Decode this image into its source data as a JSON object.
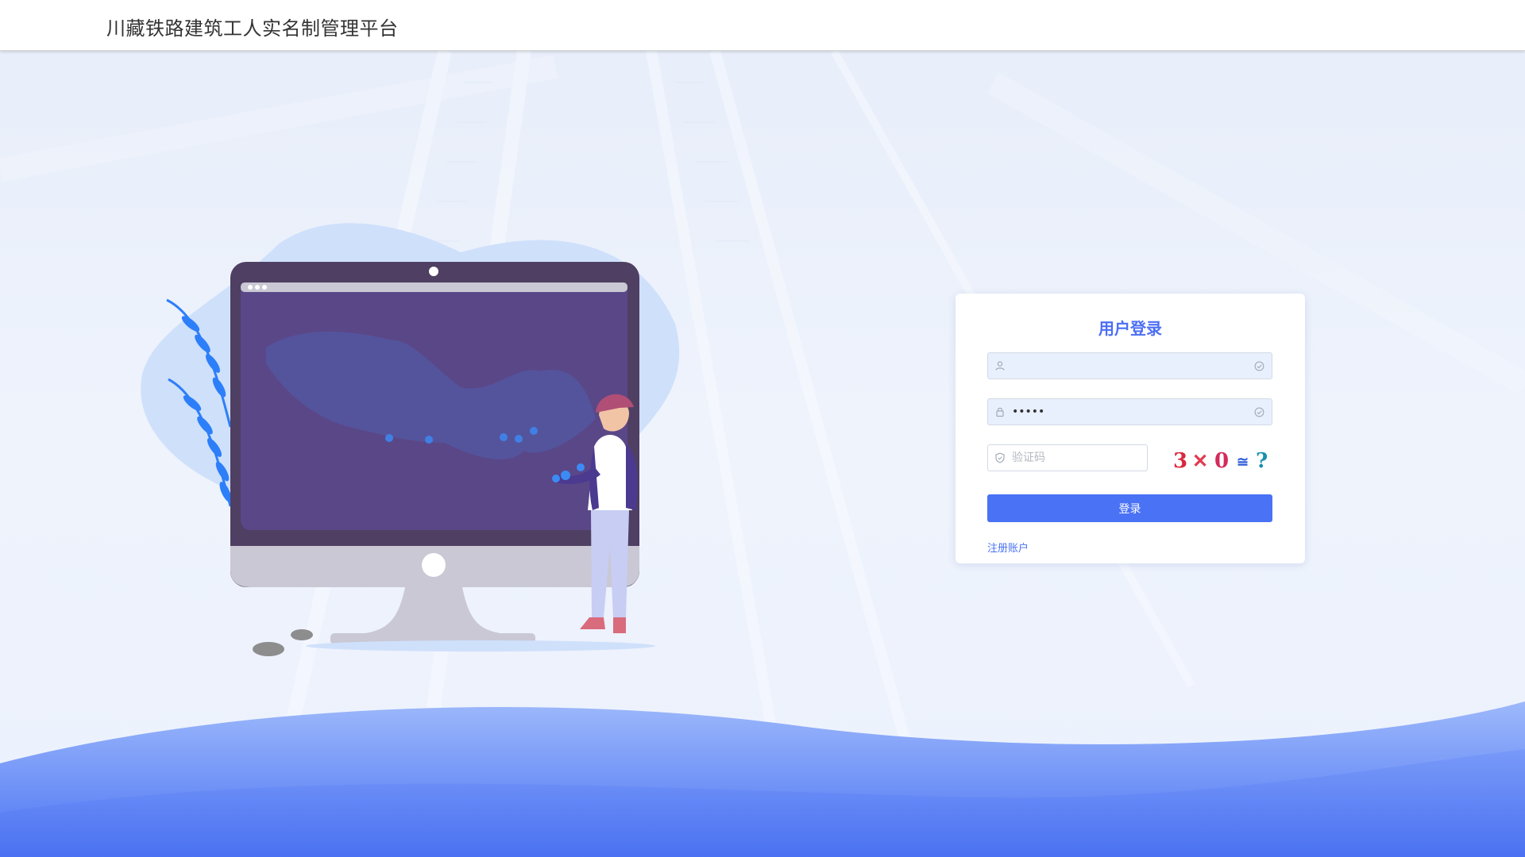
{
  "header": {
    "title": "川藏铁路建筑工人实名制管理平台"
  },
  "login": {
    "title": "用户登录",
    "username_value": "",
    "password_value": "•••••",
    "captcha_placeholder": "验证码",
    "captcha_text": [
      "3",
      "✕",
      "0",
      "≅",
      "?"
    ],
    "submit_label": "登录",
    "register_label": "注册账户"
  },
  "icons": {
    "username": "user-icon",
    "password": "lock-icon",
    "captcha": "shield-icon",
    "check": "check-circle-icon"
  },
  "colors": {
    "accent": "#4a72f5",
    "title": "#4c6ef5",
    "input_fill": "#e8f0fe",
    "wave": "#5b82f7"
  }
}
